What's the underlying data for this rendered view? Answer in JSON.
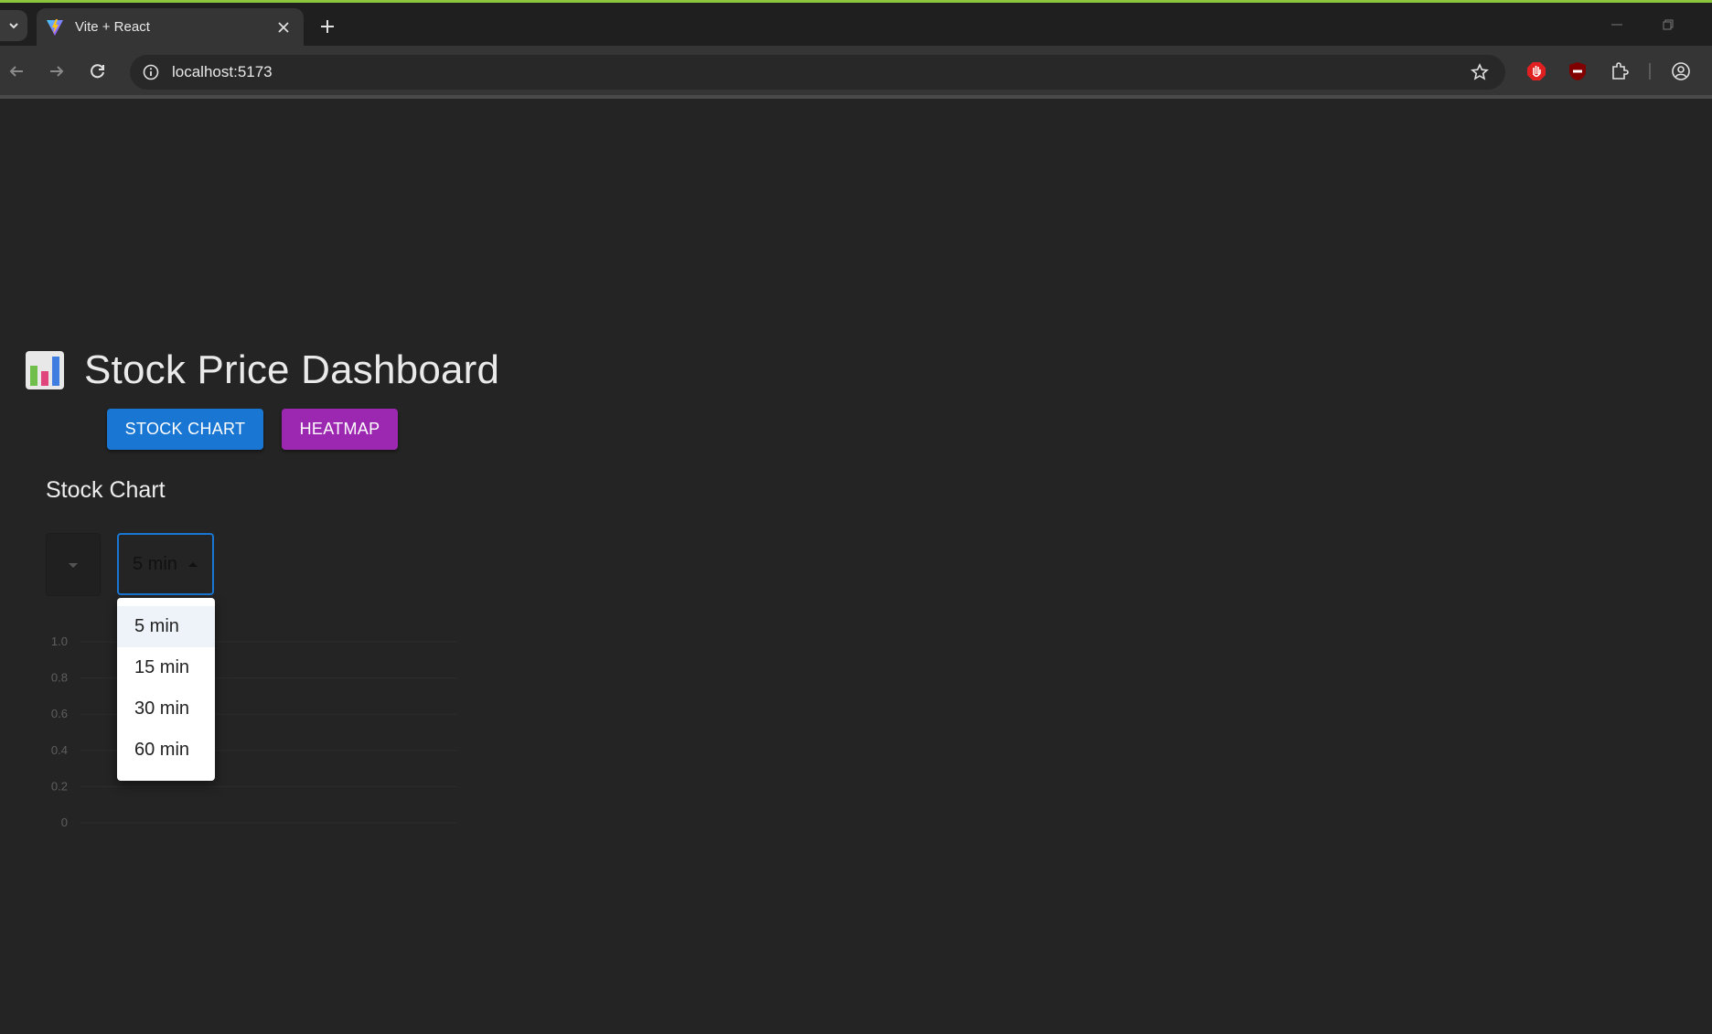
{
  "browser": {
    "tab_title": "Vite + React",
    "url": "localhost:5173",
    "accent_color": "#8cc63f"
  },
  "app": {
    "title": "Stock Price Dashboard",
    "title_icon": "bar-chart-emoji",
    "buttons": {
      "stock_chart": "STOCK CHART",
      "heatmap": "HEATMAP"
    },
    "colors": {
      "stock_chart_button": "#1976d2",
      "heatmap_button": "#9c27b0"
    },
    "section_title": "Stock Chart",
    "symbol_select": {
      "value": ""
    },
    "interval_select": {
      "value": "5 min",
      "options": [
        "5 min",
        "15 min",
        "30 min",
        "60 min"
      ],
      "selected_index": 0
    }
  },
  "chart_data": {
    "type": "line",
    "x": [],
    "series": [],
    "ylim": [
      0,
      1.0
    ],
    "yticks": [
      "1.0",
      "0.8",
      "0.6",
      "0.4",
      "0.2",
      "0"
    ],
    "grid": true
  }
}
